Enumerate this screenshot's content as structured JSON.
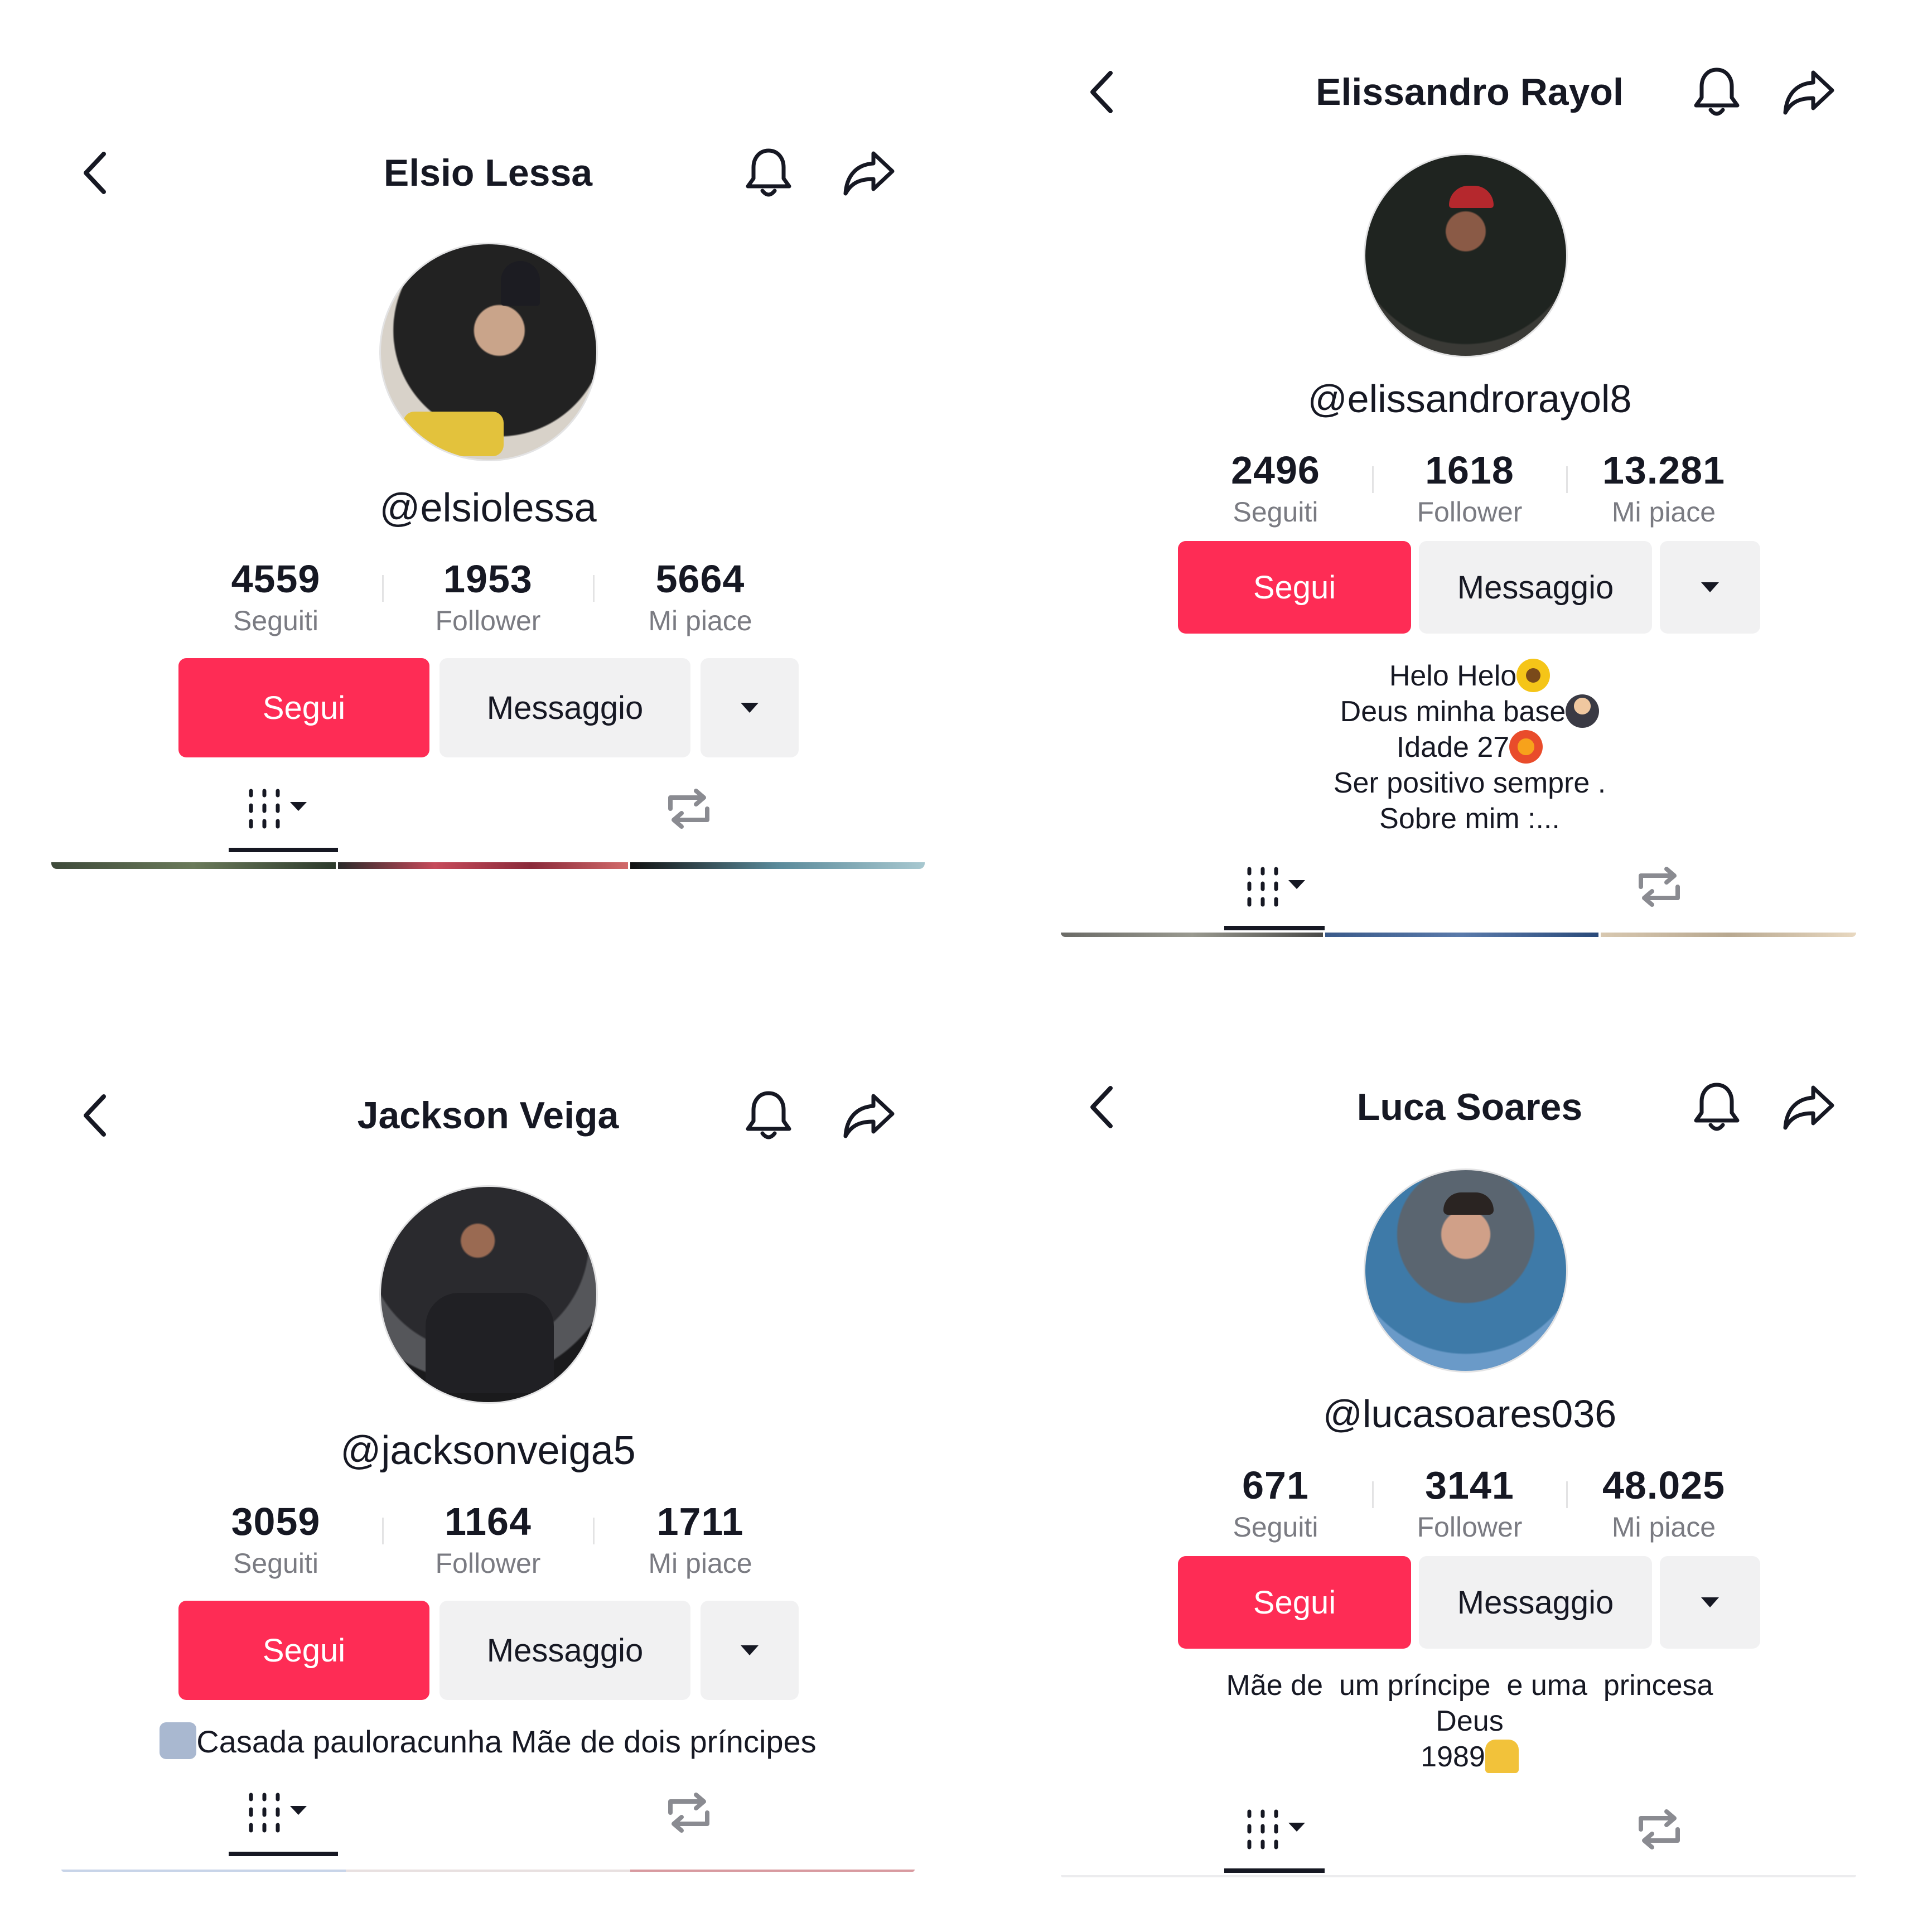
{
  "profiles": [
    {
      "title": "Elsio Lessa",
      "handle": "@elsiolessa",
      "stats": [
        {
          "value": "4559",
          "label": "Seguiti"
        },
        {
          "value": "1953",
          "label": "Follower"
        },
        {
          "value": "5664",
          "label": "Mi piace"
        }
      ],
      "buttons": {
        "follow": "Segui",
        "message": "Messaggio"
      },
      "bio": [],
      "avatar_desc": "chef-photo"
    },
    {
      "title": "Elissandro Rayol",
      "handle": "@elissandrorayol8",
      "stats": [
        {
          "value": "2496",
          "label": "Seguiti"
        },
        {
          "value": "1618",
          "label": "Follower"
        },
        {
          "value": "13.281",
          "label": "Mi piace"
        }
      ],
      "buttons": {
        "follow": "Segui",
        "message": "Messaggio"
      },
      "bio": [
        "Helo Helo",
        "Deus minha base",
        "Idade 27",
        "Ser positivo sempre .",
        "Sobre mim :..."
      ],
      "avatar_desc": "car-photo"
    },
    {
      "title": "Jackson Veiga",
      "handle": "@jacksonveiga5",
      "stats": [
        {
          "value": "3059",
          "label": "Seguiti"
        },
        {
          "value": "1164",
          "label": "Follower"
        },
        {
          "value": "1711",
          "label": "Mi piace"
        }
      ],
      "buttons": {
        "follow": "Segui",
        "message": "Messaggio"
      },
      "bio": [
        "Casada pauloracunha Mãe de dois príncipes"
      ],
      "avatar_desc": "motorcycle-photo"
    },
    {
      "title": "Luca Soares",
      "handle": "@lucasoares036",
      "stats": [
        {
          "value": "671",
          "label": "Seguiti"
        },
        {
          "value": "3141",
          "label": "Follower"
        },
        {
          "value": "48.025",
          "label": "Mi piace"
        }
      ],
      "buttons": {
        "follow": "Segui",
        "message": "Messaggio"
      },
      "bio": [
        "Mãe de  um príncipe  e uma  princesa",
        "Deus",
        "1989"
      ],
      "avatar_desc": "sea-photo"
    }
  ],
  "colors": {
    "accent": "#fe2c55",
    "button_bg": "#f1f1f2",
    "text": "#161823",
    "muted": "#7a7b82"
  },
  "icons": [
    "chevron-left-icon",
    "bell-icon",
    "share-icon",
    "caret-down-icon",
    "grid-tab-icon",
    "repost-icon"
  ]
}
